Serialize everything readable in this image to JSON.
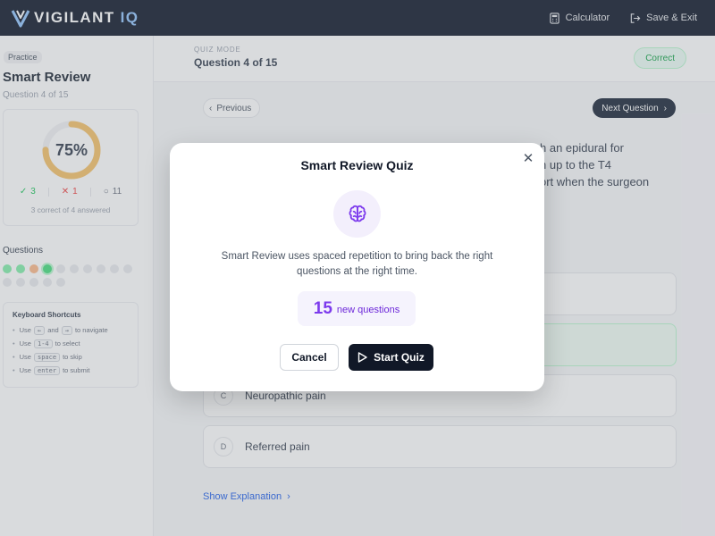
{
  "app": {
    "logo_main": "VIGILANT",
    "logo_accent": "IQ",
    "calculator_label": "Calculator",
    "save_exit_label": "Save & Exit"
  },
  "sidebar": {
    "tag": "Practice",
    "title": "Smart Review",
    "subtitle": "Question 4 of 15",
    "progress": {
      "percent_label": "75%",
      "percent_value": 0.75,
      "correct": "3",
      "incorrect": "1",
      "remaining": "11",
      "answered_text": "3 correct of 4 answered"
    },
    "questions_heading": "Questions",
    "question_dots": [
      "correct",
      "correct",
      "wrong",
      "current",
      "",
      "",
      "",
      "",
      "",
      "",
      "",
      "",
      "",
      "",
      ""
    ],
    "shortcuts": {
      "title": "Keyboard Shortcuts",
      "items": [
        {
          "pre": "Use",
          "key1": "←",
          "mid": "and",
          "key2": "→",
          "post": "to navigate"
        },
        {
          "pre": "Use",
          "key1": "1-4",
          "post": "to select"
        },
        {
          "pre": "Use",
          "key1": "space",
          "post": "to skip"
        },
        {
          "pre": "Use",
          "key1": "enter",
          "post": "to submit"
        }
      ]
    }
  },
  "main": {
    "mode": "QUIZ MODE",
    "question_number": "Question 4 of 15",
    "status_badge": "Correct",
    "prev_label": "Previous",
    "next_label": "Next Question",
    "question_line1": "h an epidural for",
    "question_line2": "n up to the T4",
    "question_line3": "ort when the surgeon",
    "options": [
      {
        "letter": "C",
        "text": "Neuropathic pain"
      },
      {
        "letter": "D",
        "text": "Referred pain"
      }
    ],
    "explanation_label": "Show Explanation"
  },
  "modal": {
    "title": "Smart Review Quiz",
    "description": "Smart Review uses spaced repetition to bring back the right questions at the right time.",
    "count": "15",
    "count_label": "new questions",
    "cancel_label": "Cancel",
    "start_label": "Start Quiz",
    "icon": "brain-icon"
  },
  "colors": {
    "accent_purple": "#7c3aed",
    "progress_orange": "#f6c26b",
    "correct_green": "#22c55e",
    "incorrect_red": "#ef4444",
    "dark_navy": "#121b2d"
  }
}
